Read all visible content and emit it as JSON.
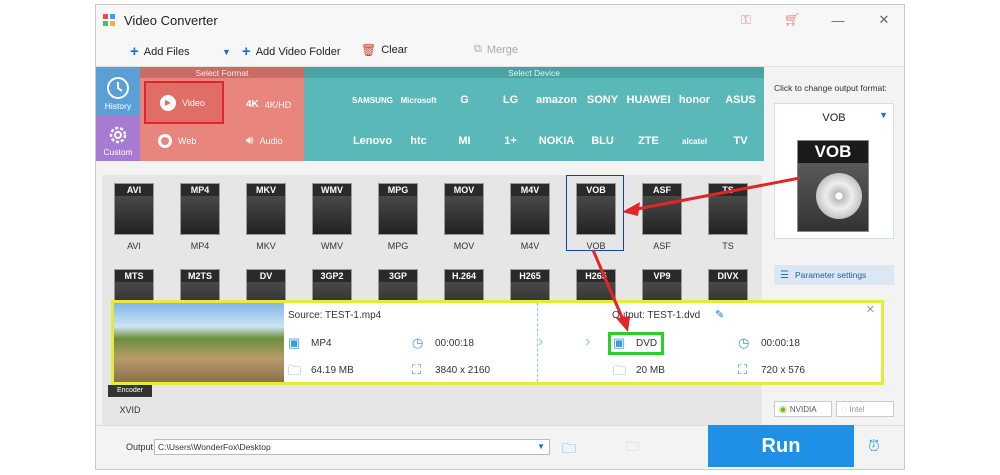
{
  "window": {
    "title": "Video Converter"
  },
  "toolbar": {
    "add_files": "Add Files",
    "add_video_folder": "Add Video Folder",
    "clear": "Clear",
    "merge": "Merge"
  },
  "sections": {
    "select_format": "Select Format",
    "select_device": "Select Device"
  },
  "sidebar": {
    "history": "History",
    "custom": "Custom"
  },
  "format_categories": [
    {
      "label": "Video"
    },
    {
      "label": "4K/HD"
    },
    {
      "label": "Web"
    },
    {
      "label": "Audio"
    }
  ],
  "devices_row1": [
    "",
    "SAMSUNG",
    "Microsoft",
    "G",
    "LG",
    "amazon",
    "SONY",
    "HUAWEI",
    "honor",
    "ASUS"
  ],
  "devices_row2": [
    "",
    "Lenovo",
    "htc",
    "MI",
    "1+",
    "NOKIA",
    "BLU",
    "ZTE",
    "alcatel",
    "TV"
  ],
  "formats_row1": [
    {
      "tag": "AVI",
      "label": "AVI"
    },
    {
      "tag": "MP4",
      "label": "MP4"
    },
    {
      "tag": "MKV",
      "label": "MKV"
    },
    {
      "tag": "WMV",
      "label": "WMV"
    },
    {
      "tag": "MPG",
      "label": "MPG"
    },
    {
      "tag": "MOV",
      "label": "MOV"
    },
    {
      "tag": "M4V",
      "label": "M4V"
    },
    {
      "tag": "VOB",
      "label": "VOB"
    },
    {
      "tag": "ASF",
      "label": "ASF"
    },
    {
      "tag": "TS",
      "label": "TS"
    }
  ],
  "formats_row2": [
    {
      "tag": "MTS"
    },
    {
      "tag": "M2TS"
    },
    {
      "tag": "DV"
    },
    {
      "tag": "3GP2"
    },
    {
      "tag": "3GP"
    },
    {
      "tag": "H.264"
    },
    {
      "tag": "H265"
    },
    {
      "tag": "H265"
    },
    {
      "tag": "VP9"
    },
    {
      "tag": "DIVX"
    }
  ],
  "encoder": {
    "label": "Encoder",
    "format": "XVID"
  },
  "output_panel": {
    "hint": "Click to change output format:",
    "format_name": "VOB",
    "format_icon_text": "VOB",
    "parameter_settings": "Parameter settings",
    "nvidia": "NVIDIA",
    "intel": "Intel"
  },
  "task": {
    "source": "Source: TEST-1.mp4",
    "src_format": "MP4",
    "src_duration": "00:00:18",
    "src_size": "64.19 MB",
    "src_resolution": "3840 x 2160",
    "output": "Output: TEST-1.dvd",
    "out_format": "DVD",
    "out_duration": "00:00:18",
    "out_size": "20 MB",
    "out_resolution": "720 x 576"
  },
  "bottom": {
    "output_folder_label": "Output folder:",
    "output_folder_value": "C:\\Users\\WonderFox\\Desktop",
    "run": "Run"
  },
  "colors": {
    "video_section": "#e8857d",
    "device_section": "#5bb8b8",
    "history": "#5a9fd6",
    "custom": "#a67bd1",
    "run": "#1e90e6",
    "highlight_red": "#e0262a",
    "highlight_blue": "#1a3fb5",
    "overlay_border": "#e6eb3a",
    "dvd_border": "#2bcf2b"
  }
}
